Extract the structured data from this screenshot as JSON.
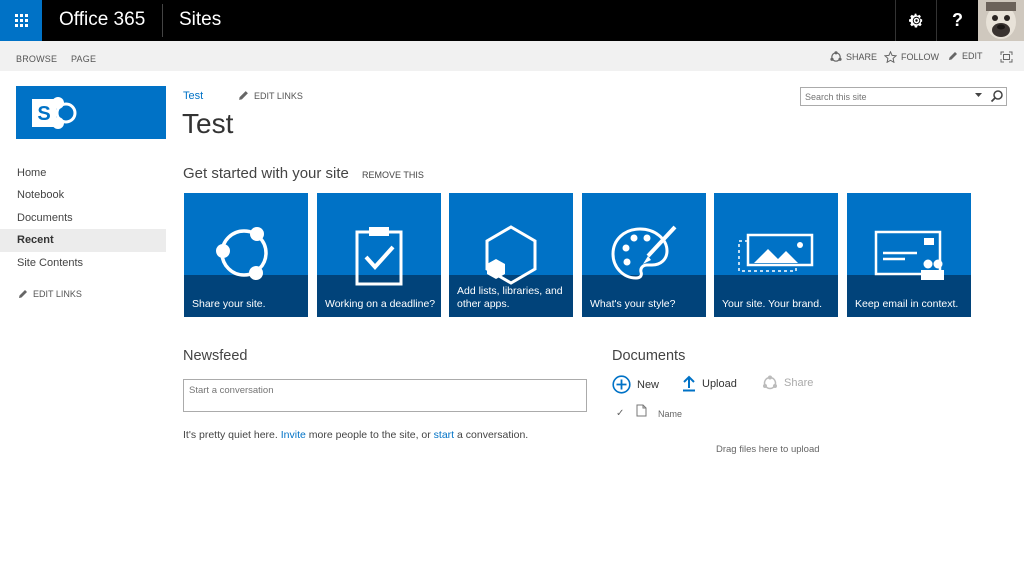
{
  "suite_bar": {
    "brand": "Office 365",
    "app_name": "Sites",
    "help_label": "?"
  },
  "ribbon": {
    "tabs": [
      "BROWSE",
      "PAGE"
    ],
    "share_label": "SHARE",
    "follow_label": "FOLLOW",
    "edit_label": "EDIT"
  },
  "quick_launch": {
    "items": [
      {
        "label": "Home",
        "selected": false
      },
      {
        "label": "Notebook",
        "selected": false
      },
      {
        "label": "Documents",
        "selected": false
      },
      {
        "label": "Recent",
        "selected": true
      },
      {
        "label": "Site Contents",
        "selected": false
      }
    ],
    "edit_links_label": "EDIT LINKS"
  },
  "header": {
    "breadcrumb": "Test",
    "edit_links_label": "EDIT LINKS",
    "page_title": "Test"
  },
  "search": {
    "placeholder": "Search this site"
  },
  "get_started": {
    "title": "Get started with your site",
    "remove_label": "REMOVE THIS",
    "tiles": [
      {
        "label": "Share your site.",
        "icon": "share-icon"
      },
      {
        "label": "Working on a deadline?",
        "icon": "clipboard-check-icon"
      },
      {
        "label": "Add lists, libraries, and other apps.",
        "icon": "hexagon-app-icon"
      },
      {
        "label": "What's your style?",
        "icon": "palette-icon"
      },
      {
        "label": "Your site. Your brand.",
        "icon": "image-brand-icon"
      },
      {
        "label": "Keep email in context.",
        "icon": "email-contacts-icon"
      }
    ]
  },
  "newsfeed": {
    "title": "Newsfeed",
    "placeholder": "Start a conversation",
    "quiet_prefix": "It's pretty quiet here. ",
    "invite_link": "Invite",
    "quiet_middle": " more people to the site, or ",
    "start_link": "start",
    "quiet_suffix": " a conversation."
  },
  "documents": {
    "title": "Documents",
    "new_label": "New",
    "upload_label": "Upload",
    "share_label": "Share",
    "column_name": "Name",
    "drag_hint": "Drag files here to upload"
  },
  "colors": {
    "accent": "#0072c6",
    "tile_band": "#01437a",
    "suite_bar": "#000000"
  }
}
